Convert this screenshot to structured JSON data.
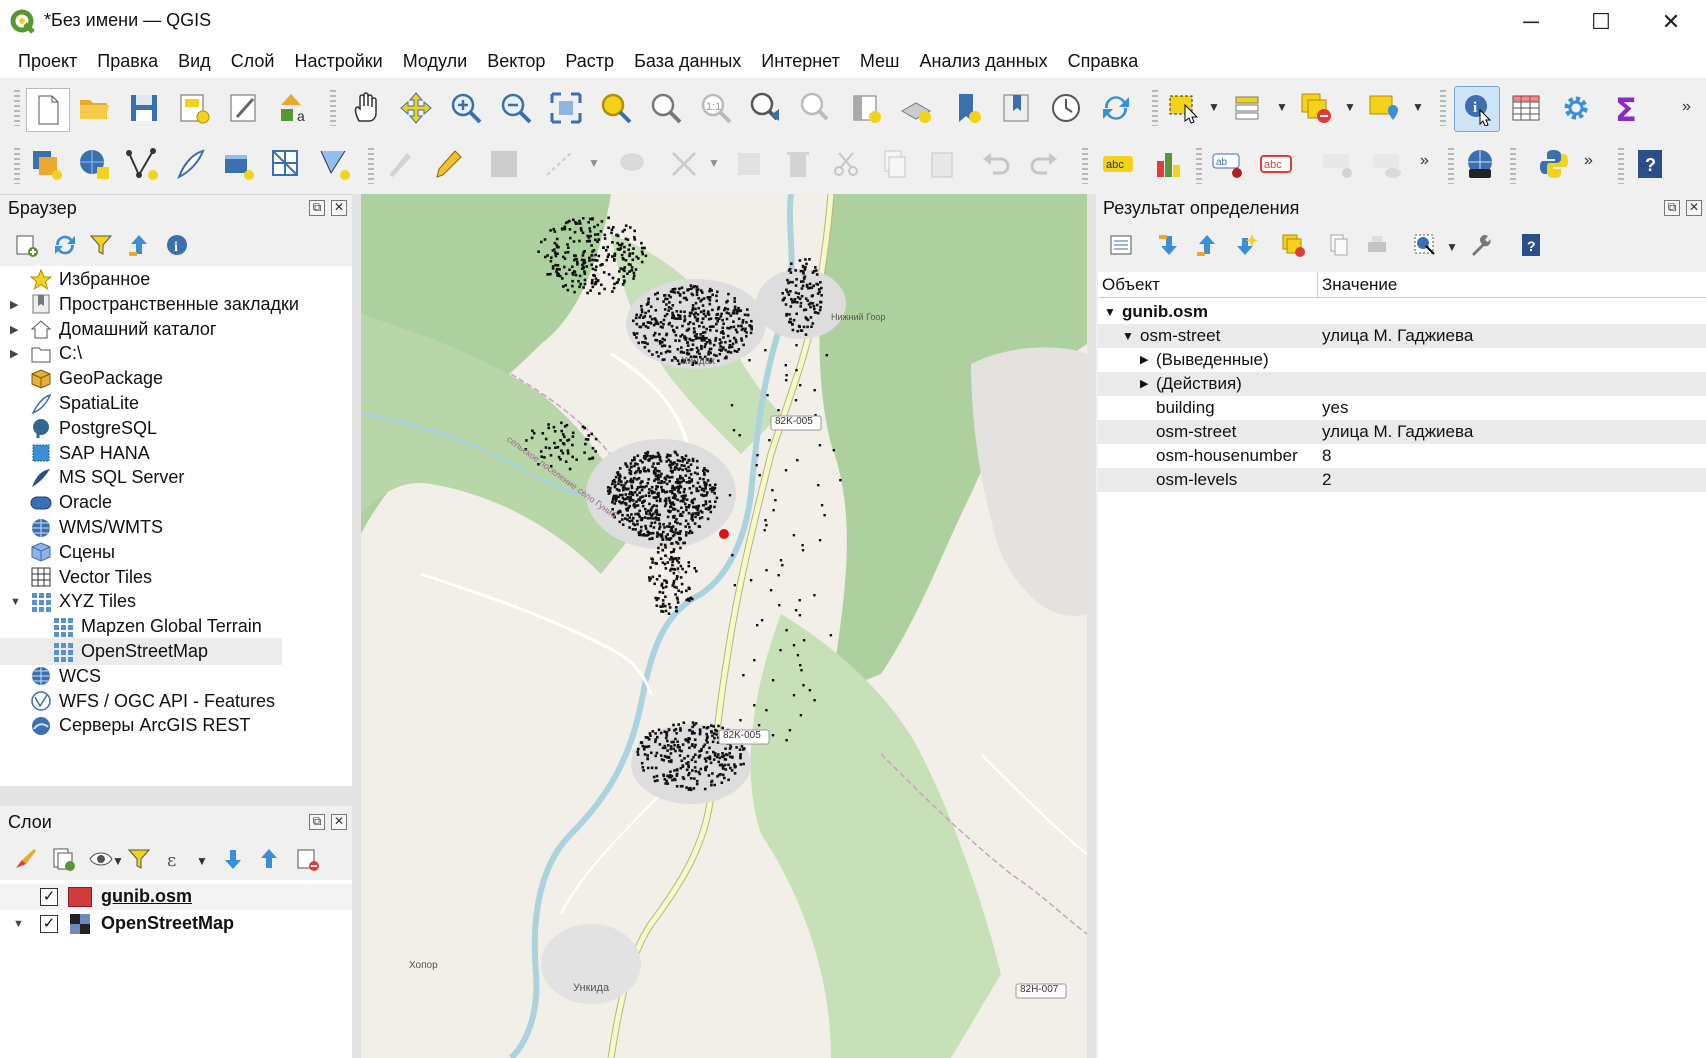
{
  "window": {
    "title": "*Без имени — QGIS",
    "minimize": "─",
    "maximize": "☐",
    "close": "✕"
  },
  "menu": [
    "Проект",
    "Правка",
    "Вид",
    "Слой",
    "Настройки",
    "Модули",
    "Вектор",
    "Растр",
    "База данных",
    "Интернет",
    "Меш",
    "Анализ данных",
    "Справка"
  ],
  "browser": {
    "title": "Браузер",
    "items": [
      {
        "label": "Избранное",
        "icon": "star-icon",
        "arrow": "",
        "indent": 0
      },
      {
        "label": "Пространственные закладки",
        "icon": "bookmark-icon",
        "arrow": "▶",
        "indent": 0
      },
      {
        "label": "Домашний каталог",
        "icon": "home-icon",
        "arrow": "▶",
        "indent": 0
      },
      {
        "label": "C:\\",
        "icon": "folder-icon",
        "arrow": "▶",
        "indent": 0
      },
      {
        "label": "GeoPackage",
        "icon": "geopackage-icon",
        "arrow": "",
        "indent": 0
      },
      {
        "label": "SpatiaLite",
        "icon": "spatialite-icon",
        "arrow": "",
        "indent": 0
      },
      {
        "label": "PostgreSQL",
        "icon": "postgresql-icon",
        "arrow": "",
        "indent": 0
      },
      {
        "label": "SAP HANA",
        "icon": "sap-hana-icon",
        "arrow": "",
        "indent": 0
      },
      {
        "label": "MS SQL Server",
        "icon": "mssql-icon",
        "arrow": "",
        "indent": 0
      },
      {
        "label": "Oracle",
        "icon": "oracle-icon",
        "arrow": "",
        "indent": 0
      },
      {
        "label": "WMS/WMTS",
        "icon": "globe-icon",
        "arrow": "",
        "indent": 0
      },
      {
        "label": "Сцены",
        "icon": "cube-icon",
        "arrow": "",
        "indent": 0
      },
      {
        "label": "Vector Tiles",
        "icon": "grid-icon",
        "arrow": "",
        "indent": 0
      },
      {
        "label": "XYZ Tiles",
        "icon": "grid-blue-icon",
        "arrow": "▼",
        "indent": 0
      },
      {
        "label": "Mapzen Global Terrain",
        "icon": "grid-blue-icon",
        "arrow": "",
        "indent": 1
      },
      {
        "label": "OpenStreetMap",
        "icon": "grid-blue-icon",
        "arrow": "",
        "indent": 1
      },
      {
        "label": "WCS",
        "icon": "globe-icon",
        "arrow": "",
        "indent": 0
      },
      {
        "label": "WFS / OGC API - Features",
        "icon": "wfs-icon",
        "arrow": "",
        "indent": 0
      },
      {
        "label": "Серверы ArcGIS REST",
        "icon": "arcgis-icon",
        "arrow": "",
        "indent": 0
      }
    ]
  },
  "layers": {
    "title": "Слои",
    "items": [
      {
        "label": "gunib.osm",
        "checked": "✓",
        "arrow": "",
        "color": "#d03a3a"
      },
      {
        "label": "OpenStreetMap",
        "checked": "✓",
        "arrow": "▼",
        "color": ""
      }
    ]
  },
  "map": {
    "labels": [
      "82K-005",
      "82K-005",
      "82Н-007",
      "Хопор",
      "Ункида",
      "Хиндах",
      "Нижний Гоор",
      "сельское поселение село Гуниб"
    ]
  },
  "identify": {
    "title": "Результат определения",
    "col_object": "Объект",
    "col_value": "Значение",
    "layer": "gunib.osm",
    "feature": {
      "key": "osm-street",
      "value": "улица М. Гаджиева"
    },
    "groups": [
      "(Выведенные)",
      "(Действия)"
    ],
    "attributes": [
      {
        "key": "building",
        "value": "yes"
      },
      {
        "key": "osm-street",
        "value": "улица М. Гаджиева"
      },
      {
        "key": "osm-housenumber",
        "value": "8"
      },
      {
        "key": "osm-levels",
        "value": "2"
      }
    ]
  },
  "colors": {
    "accent_red": "#d03a3a",
    "qgis_green": "#589632",
    "select_yellow": "#f3d31a",
    "road_yellow": "#f7fabf"
  }
}
